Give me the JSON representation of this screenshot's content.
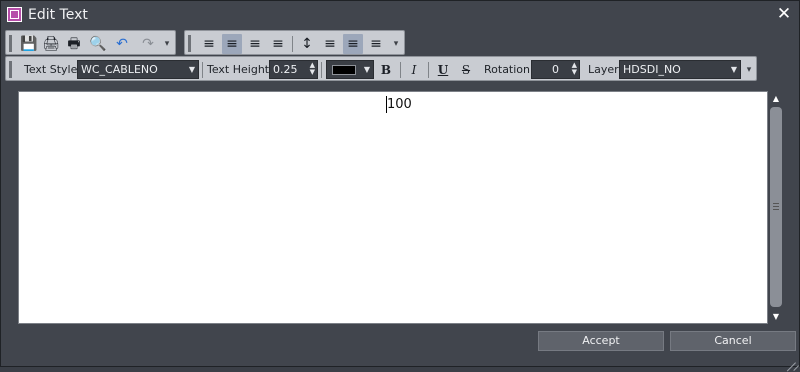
{
  "window": {
    "title": "Edit Text",
    "close_glyph": "✕"
  },
  "toolbar1": {
    "left_icons": [
      {
        "name": "save-icon",
        "glyph": "💾"
      },
      {
        "name": "print-icon",
        "glyph": "🖨"
      },
      {
        "name": "print-preview-icon",
        "glyph": "🖶"
      },
      {
        "name": "find-icon",
        "glyph": "🔍"
      },
      {
        "name": "undo-icon",
        "glyph": "↶"
      },
      {
        "name": "redo-icon",
        "glyph": "↷"
      }
    ],
    "align_icons": [
      {
        "name": "align-left-icon",
        "glyph": "≡"
      },
      {
        "name": "align-center-icon",
        "glyph": "≡"
      },
      {
        "name": "align-right-icon",
        "glyph": "≡"
      },
      {
        "name": "align-justify-icon",
        "glyph": "≡"
      },
      {
        "name": "valign-icon",
        "glyph": "↕"
      },
      {
        "name": "line-spacing-icon",
        "glyph": "≡"
      },
      {
        "name": "paragraph-top-icon",
        "glyph": "≡"
      },
      {
        "name": "paragraph-bottom-icon",
        "glyph": "≡"
      }
    ]
  },
  "toolbar2": {
    "text_style_label": "Text Style",
    "text_style_value": "WC_CABLENO",
    "text_height_label": "Text Height",
    "text_height_value": "0.25",
    "color_value": "#000000",
    "bold": "B",
    "italic": "I",
    "underline": "U",
    "strike": "S",
    "rotation_label": "Rotation",
    "rotation_value": "0",
    "layer_label": "Layer",
    "layer_value": "HDSDI_NO"
  },
  "editor": {
    "text": "100"
  },
  "buttons": {
    "accept": "Accept",
    "cancel": "Cancel"
  }
}
